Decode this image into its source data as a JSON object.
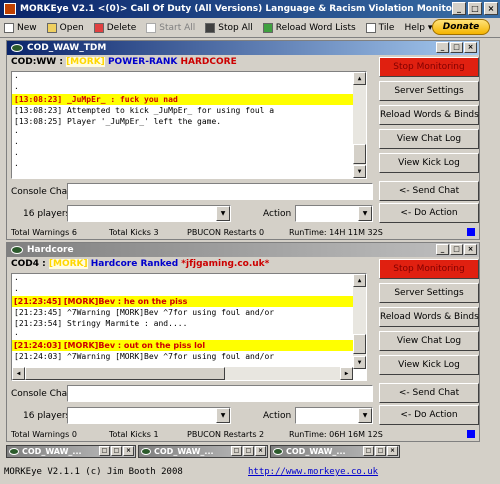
{
  "window": {
    "title": "MORKEye V2.1 <(0)> Call Of Duty (All Versions) Language & Racism Violation Monitor"
  },
  "toolbar": {
    "new": "New",
    "open": "Open",
    "delete": "Delete",
    "start_all": "Start All",
    "stop_all": "Stop All",
    "reload": "Reload Word Lists",
    "tile": "Tile",
    "help": "Help",
    "help_arrow": "▾",
    "donate": "Donate"
  },
  "panel1": {
    "tab": "COD_WAW_TDM",
    "server": {
      "prefix": "COD:WW :",
      "tag": "[MORK]",
      "name": "POWER-RANK",
      "mode": "HARDCORE"
    },
    "chat": [
      "·",
      "·",
      "[13:08:23] _JuMpEr_ : fuck you nad",
      "[13:08:23] Attempted to kick _JuMpEr_ for using foul a",
      "[13:08:25] Player '_JuMpEr_' left the game.",
      "·",
      "·",
      "·",
      "·"
    ],
    "buttons": {
      "stop": "Stop Monitoring",
      "settings": "Server Settings",
      "reload": "Reload Words & Binds",
      "chatlog": "View Chat Log",
      "kicklog": "View Kick Log",
      "send": "<-      Send Chat",
      "action": "<-      Do Action"
    },
    "console_label": "Console Chat",
    "players": "16 players",
    "action_label": "Action",
    "status": {
      "warnings": "Total Warnings 6",
      "kicks": "Total Kicks 3",
      "restarts": "PBUCON Restarts 0",
      "runtime": "RunTime: 14H 11M 32S"
    }
  },
  "panel2": {
    "tab": "Hardcore",
    "server": {
      "prefix": "COD4 :",
      "tag": "[MORK]",
      "name": "Hardcore Ranked",
      "site": "*jfjgaming.co.uk*"
    },
    "chat": [
      "·",
      "·",
      "[21:23:45] [MORK]Bev : he on the piss",
      "[21:23:45] ^7Warning [MORK]Bev ^7for using foul and/or",
      "[21:23:54] Stringy Marmite : and....",
      "·",
      "[21:24:03] [MORK]Bev : out on the piss lol",
      "[21:24:03] ^7Warning [MORK]Bev ^7for using foul and/or"
    ],
    "buttons": {
      "stop": "Stop Monitoring",
      "settings": "Server Settings",
      "reload": "Reload Words & Binds",
      "chatlog": "View Chat Log",
      "kicklog": "View Kick Log",
      "send": "<-      Send Chat",
      "action": "<-      Do Action"
    },
    "console_label": "Console Chat",
    "players": "16 players",
    "action_label": "Action",
    "status": {
      "warnings": "Total Warnings 0",
      "kicks": "Total Kicks 1",
      "restarts": "PBUCON Restarts 2",
      "runtime": "RunTime: 06H 16M 12S"
    }
  },
  "taskbar": [
    "COD_WAW_...",
    "COD_WAW_...",
    "COD_WAW_..."
  ],
  "footer": {
    "credit": "MORKEye V2.1.1 (c) Jim Booth 2008",
    "url": "http://www.morkeye.co.uk"
  },
  "colors": {
    "highlight": "#ffff00",
    "stop_button": "#e02010",
    "title_active": "#0a246a"
  }
}
